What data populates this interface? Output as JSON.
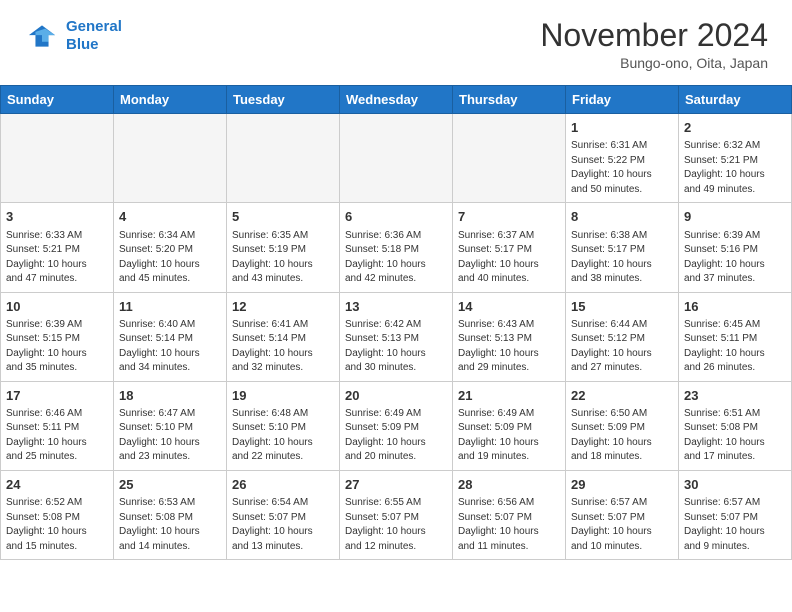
{
  "header": {
    "logo_line1": "General",
    "logo_line2": "Blue",
    "month": "November 2024",
    "location": "Bungo-ono, Oita, Japan"
  },
  "weekdays": [
    "Sunday",
    "Monday",
    "Tuesday",
    "Wednesday",
    "Thursday",
    "Friday",
    "Saturday"
  ],
  "weeks": [
    [
      {
        "day": "",
        "info": ""
      },
      {
        "day": "",
        "info": ""
      },
      {
        "day": "",
        "info": ""
      },
      {
        "day": "",
        "info": ""
      },
      {
        "day": "",
        "info": ""
      },
      {
        "day": "1",
        "info": "Sunrise: 6:31 AM\nSunset: 5:22 PM\nDaylight: 10 hours\nand 50 minutes."
      },
      {
        "day": "2",
        "info": "Sunrise: 6:32 AM\nSunset: 5:21 PM\nDaylight: 10 hours\nand 49 minutes."
      }
    ],
    [
      {
        "day": "3",
        "info": "Sunrise: 6:33 AM\nSunset: 5:21 PM\nDaylight: 10 hours\nand 47 minutes."
      },
      {
        "day": "4",
        "info": "Sunrise: 6:34 AM\nSunset: 5:20 PM\nDaylight: 10 hours\nand 45 minutes."
      },
      {
        "day": "5",
        "info": "Sunrise: 6:35 AM\nSunset: 5:19 PM\nDaylight: 10 hours\nand 43 minutes."
      },
      {
        "day": "6",
        "info": "Sunrise: 6:36 AM\nSunset: 5:18 PM\nDaylight: 10 hours\nand 42 minutes."
      },
      {
        "day": "7",
        "info": "Sunrise: 6:37 AM\nSunset: 5:17 PM\nDaylight: 10 hours\nand 40 minutes."
      },
      {
        "day": "8",
        "info": "Sunrise: 6:38 AM\nSunset: 5:17 PM\nDaylight: 10 hours\nand 38 minutes."
      },
      {
        "day": "9",
        "info": "Sunrise: 6:39 AM\nSunset: 5:16 PM\nDaylight: 10 hours\nand 37 minutes."
      }
    ],
    [
      {
        "day": "10",
        "info": "Sunrise: 6:39 AM\nSunset: 5:15 PM\nDaylight: 10 hours\nand 35 minutes."
      },
      {
        "day": "11",
        "info": "Sunrise: 6:40 AM\nSunset: 5:14 PM\nDaylight: 10 hours\nand 34 minutes."
      },
      {
        "day": "12",
        "info": "Sunrise: 6:41 AM\nSunset: 5:14 PM\nDaylight: 10 hours\nand 32 minutes."
      },
      {
        "day": "13",
        "info": "Sunrise: 6:42 AM\nSunset: 5:13 PM\nDaylight: 10 hours\nand 30 minutes."
      },
      {
        "day": "14",
        "info": "Sunrise: 6:43 AM\nSunset: 5:13 PM\nDaylight: 10 hours\nand 29 minutes."
      },
      {
        "day": "15",
        "info": "Sunrise: 6:44 AM\nSunset: 5:12 PM\nDaylight: 10 hours\nand 27 minutes."
      },
      {
        "day": "16",
        "info": "Sunrise: 6:45 AM\nSunset: 5:11 PM\nDaylight: 10 hours\nand 26 minutes."
      }
    ],
    [
      {
        "day": "17",
        "info": "Sunrise: 6:46 AM\nSunset: 5:11 PM\nDaylight: 10 hours\nand 25 minutes."
      },
      {
        "day": "18",
        "info": "Sunrise: 6:47 AM\nSunset: 5:10 PM\nDaylight: 10 hours\nand 23 minutes."
      },
      {
        "day": "19",
        "info": "Sunrise: 6:48 AM\nSunset: 5:10 PM\nDaylight: 10 hours\nand 22 minutes."
      },
      {
        "day": "20",
        "info": "Sunrise: 6:49 AM\nSunset: 5:09 PM\nDaylight: 10 hours\nand 20 minutes."
      },
      {
        "day": "21",
        "info": "Sunrise: 6:49 AM\nSunset: 5:09 PM\nDaylight: 10 hours\nand 19 minutes."
      },
      {
        "day": "22",
        "info": "Sunrise: 6:50 AM\nSunset: 5:09 PM\nDaylight: 10 hours\nand 18 minutes."
      },
      {
        "day": "23",
        "info": "Sunrise: 6:51 AM\nSunset: 5:08 PM\nDaylight: 10 hours\nand 17 minutes."
      }
    ],
    [
      {
        "day": "24",
        "info": "Sunrise: 6:52 AM\nSunset: 5:08 PM\nDaylight: 10 hours\nand 15 minutes."
      },
      {
        "day": "25",
        "info": "Sunrise: 6:53 AM\nSunset: 5:08 PM\nDaylight: 10 hours\nand 14 minutes."
      },
      {
        "day": "26",
        "info": "Sunrise: 6:54 AM\nSunset: 5:07 PM\nDaylight: 10 hours\nand 13 minutes."
      },
      {
        "day": "27",
        "info": "Sunrise: 6:55 AM\nSunset: 5:07 PM\nDaylight: 10 hours\nand 12 minutes."
      },
      {
        "day": "28",
        "info": "Sunrise: 6:56 AM\nSunset: 5:07 PM\nDaylight: 10 hours\nand 11 minutes."
      },
      {
        "day": "29",
        "info": "Sunrise: 6:57 AM\nSunset: 5:07 PM\nDaylight: 10 hours\nand 10 minutes."
      },
      {
        "day": "30",
        "info": "Sunrise: 6:57 AM\nSunset: 5:07 PM\nDaylight: 10 hours\nand 9 minutes."
      }
    ]
  ]
}
